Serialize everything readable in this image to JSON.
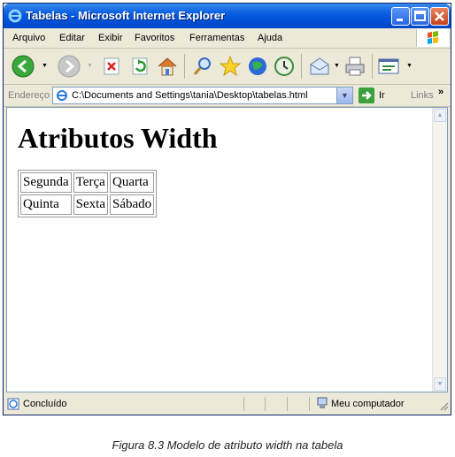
{
  "window": {
    "title": "Tabelas - Microsoft Internet Explorer"
  },
  "menu": [
    {
      "label": "Arquivo"
    },
    {
      "label": "Editar"
    },
    {
      "label": "Exibir"
    },
    {
      "label": "Favoritos"
    },
    {
      "label": "Ferramentas"
    },
    {
      "label": "Ajuda"
    }
  ],
  "toolbar": {
    "icons": [
      "back-icon",
      "forward-icon",
      "stop-icon",
      "refresh-icon",
      "home-icon",
      "search-icon",
      "favorites-icon",
      "media-icon",
      "history-icon",
      "mail-icon",
      "print-icon",
      "edit-icon"
    ]
  },
  "address": {
    "label": "Endereço",
    "url": "C:\\Documents and Settings\\tania\\Desktop\\tabelas.html",
    "go_label": "Ir",
    "links_label": "Links"
  },
  "page": {
    "heading": "Atributos Width",
    "table": {
      "rows": [
        [
          "Segunda",
          "Terça",
          "Quarta"
        ],
        [
          "Quinta",
          "Sexta",
          "Sábado"
        ]
      ]
    }
  },
  "status": {
    "text": "Concluído",
    "zone": "Meu computador"
  },
  "caption": "Figura 8.3 Modelo de atributo width na tabela"
}
